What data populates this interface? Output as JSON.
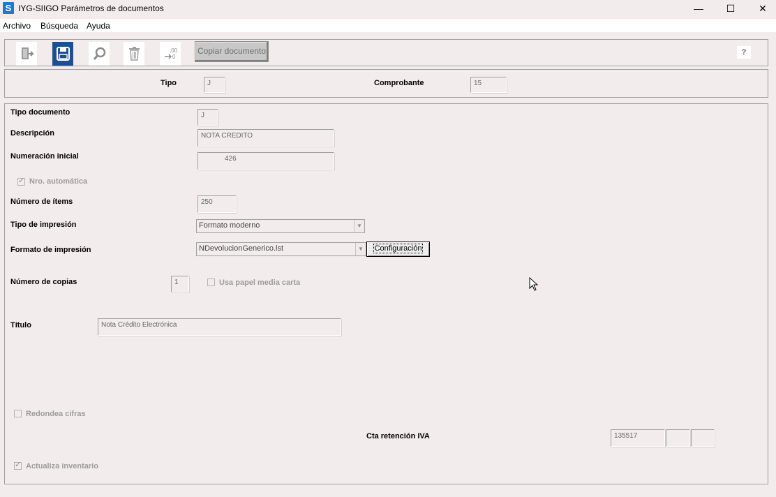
{
  "window": {
    "app_icon_letter": "S",
    "title": "IYG-SIIGO  Parámetros de documentos",
    "minimize": "—",
    "maximize": "☐",
    "close": "✕"
  },
  "menu": {
    "items": [
      {
        "label": "Archivo"
      },
      {
        "label": "Búsqueda"
      },
      {
        "label": "Ayuda"
      }
    ]
  },
  "toolbar": {
    "buttons": [
      {
        "icon": "exit-icon"
      },
      {
        "icon": "save-icon",
        "active": true
      },
      {
        "icon": "search-icon"
      },
      {
        "icon": "trash-icon"
      },
      {
        "icon": "renumber-icon",
        "label": ",00\n→0"
      }
    ],
    "copy_document_label": "Copiar documento",
    "help_label": "?"
  },
  "header": {
    "tipo_label": "Tipo",
    "tipo_value": "J",
    "comprobante_label": "Comprobante",
    "comprobante_value": "15"
  },
  "form": {
    "tipo_documento_label": "Tipo documento",
    "tipo_documento_value": "J",
    "descripcion_label": "Descripción",
    "descripcion_value": "NOTA CREDITO",
    "numeracion_label": "Numeración inicial",
    "numeracion_value": "426",
    "nro_automatica_label": "Nro. automática",
    "nro_automatica_checked": true,
    "numero_items_label": "Número de ítems",
    "numero_items_value": "250",
    "tipo_impresion_label": "Tipo de impresión",
    "tipo_impresion_value": "Formato moderno",
    "formato_impresion_label": "Formato de impresión",
    "formato_impresion_value": "NDevolucionGenerico.lst",
    "configuracion_label": "Configuración",
    "numero_copias_label": "Número de copias",
    "numero_copias_value": "1",
    "media_carta_label": "Usa papel media carta",
    "media_carta_checked": false,
    "titulo_label": "Título",
    "titulo_value": "Nota Crédito Electrónica",
    "redondea_label": "Redondea cifras",
    "redondea_checked": false,
    "cta_retencion_label": "Cta retención IVA",
    "cta_retencion_value": "135517",
    "cta_retencion_sub1": "",
    "cta_retencion_sub2": "",
    "actualiza_label": "Actualiza inventario",
    "actualiza_checked": true
  },
  "colors": {
    "background": "#f3ecec",
    "active_tool": "#1d4f91",
    "app_icon": "#1b7bd1"
  }
}
